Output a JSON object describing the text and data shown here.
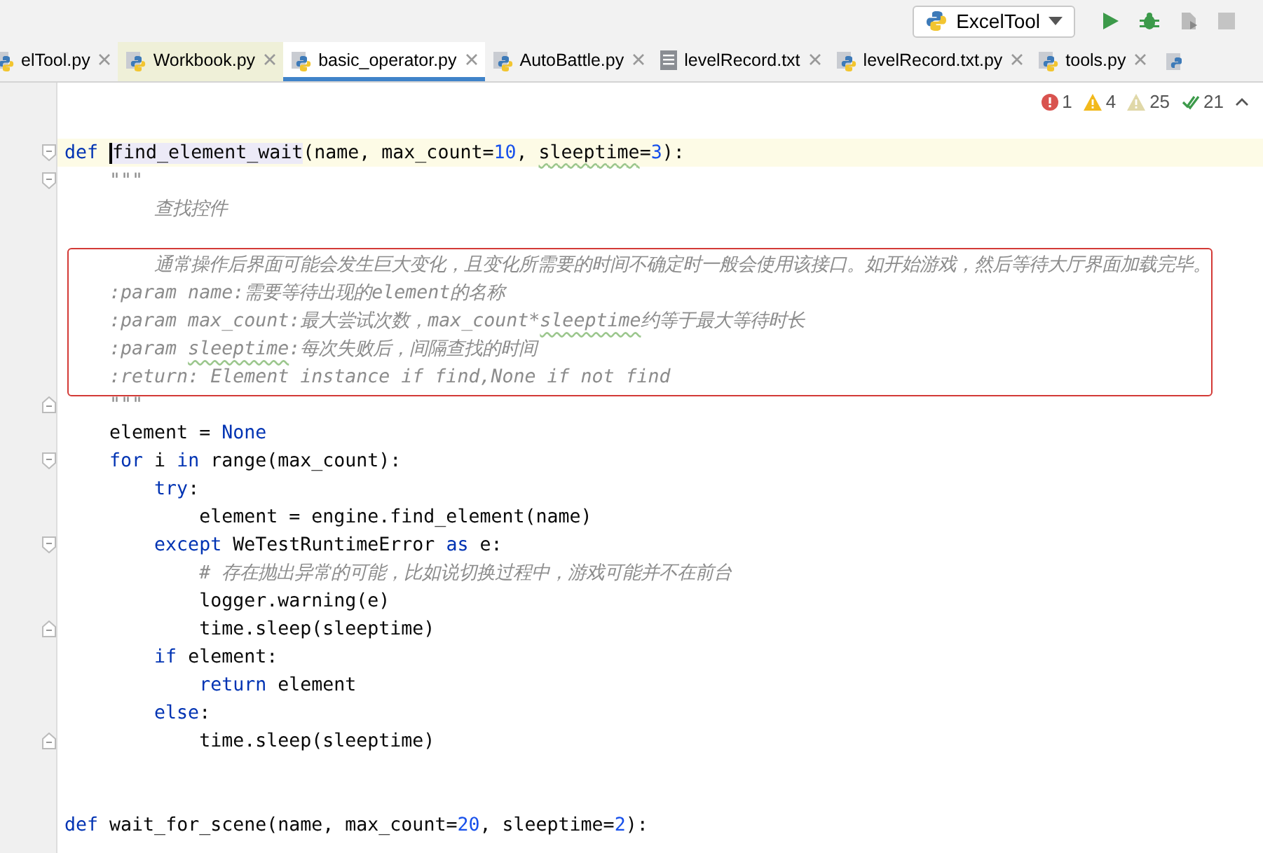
{
  "toolbar": {
    "run_config": "ExcelTool",
    "actions": [
      {
        "kind": "run",
        "disabled": false
      },
      {
        "kind": "debug",
        "disabled": false
      },
      {
        "kind": "coverage",
        "disabled": true
      },
      {
        "kind": "stop",
        "disabled": true
      }
    ]
  },
  "tabs": [
    {
      "label": "elTool.py",
      "kind": "python",
      "selected": false,
      "highlighted": false
    },
    {
      "label": "Workbook.py",
      "kind": "python",
      "selected": false,
      "highlighted": true
    },
    {
      "label": "basic_operator.py",
      "kind": "python",
      "selected": true,
      "highlighted": false
    },
    {
      "label": "AutoBattle.py",
      "kind": "python",
      "selected": false,
      "highlighted": false
    },
    {
      "label": "levelRecord.txt",
      "kind": "text",
      "selected": false,
      "highlighted": false
    },
    {
      "label": "levelRecord.txt.py",
      "kind": "python",
      "selected": false,
      "highlighted": false
    },
    {
      "label": "tools.py",
      "kind": "python",
      "selected": false,
      "highlighted": false
    }
  ],
  "inspections": [
    {
      "kind": "error",
      "count": "1"
    },
    {
      "kind": "warning",
      "count": "4"
    },
    {
      "kind": "weak",
      "count": "25"
    },
    {
      "kind": "typo",
      "count": "21"
    }
  ],
  "lines": [
    {
      "kind": "blank"
    },
    {
      "kind": "blank"
    },
    {
      "kind": "code",
      "current": true,
      "fold_start": true,
      "tokens": [
        {
          "kind": "keyword",
          "text": "def "
        },
        {
          "kind": "matched",
          "text": "find_element_wait",
          "caret": true
        },
        {
          "kind": "plain",
          "text": "(name, max_count="
        },
        {
          "kind": "number",
          "text": "10"
        },
        {
          "kind": "plain",
          "text": ", "
        },
        {
          "kind": "typo",
          "text": "sleeptime"
        },
        {
          "kind": "plain",
          "text": "="
        },
        {
          "kind": "number",
          "text": "3"
        },
        {
          "kind": "plain",
          "text": "):"
        }
      ]
    },
    {
      "kind": "code",
      "fold_start": true,
      "tokens": [
        {
          "kind": "doc",
          "text": "    \"\"\""
        }
      ]
    },
    {
      "kind": "code",
      "tokens": [
        {
          "kind": "doc",
          "text": "        查找控件"
        }
      ]
    },
    {
      "kind": "blank"
    },
    {
      "kind": "code",
      "annotated": true,
      "tokens": [
        {
          "kind": "doc",
          "text": "        通常操作后界面可能会发生巨大变化，且变化所需要的时间不确定时一般会使用该接口。如开始游戏，然后等待大厅界面加载完毕。"
        }
      ]
    },
    {
      "kind": "code",
      "annotated": true,
      "tokens": [
        {
          "kind": "doc",
          "text": "    :param name:需要等待出现的element的名称"
        }
      ]
    },
    {
      "kind": "code",
      "annotated": true,
      "tokens": [
        {
          "kind": "doc",
          "text": "    :param max_count:最大尝试次数，max_count*"
        },
        {
          "kind": "doctypo",
          "text": "sleeptime"
        },
        {
          "kind": "doc",
          "text": "约等于最大等待时长"
        }
      ]
    },
    {
      "kind": "code",
      "annotated": true,
      "tokens": [
        {
          "kind": "doc",
          "text": "    :param "
        },
        {
          "kind": "doctypo",
          "text": "sleeptime"
        },
        {
          "kind": "doc",
          "text": ":每次失败后，间隔查找的时间"
        }
      ]
    },
    {
      "kind": "code",
      "annotated": true,
      "tokens": [
        {
          "kind": "doc",
          "text": "    :return: Element instance if find,None if not find"
        }
      ]
    },
    {
      "kind": "code",
      "fold_end": true,
      "tokens": [
        {
          "kind": "doc",
          "text": "    \"\"\""
        }
      ]
    },
    {
      "kind": "code",
      "tokens": [
        {
          "kind": "plain",
          "text": "    element = "
        },
        {
          "kind": "keyword",
          "text": "None"
        }
      ]
    },
    {
      "kind": "code",
      "fold_start": true,
      "tokens": [
        {
          "kind": "keyword",
          "text": "    for"
        },
        {
          "kind": "plain",
          "text": " i "
        },
        {
          "kind": "keyword",
          "text": "in"
        },
        {
          "kind": "plain",
          "text": " range(max_count):"
        }
      ]
    },
    {
      "kind": "code",
      "tokens": [
        {
          "kind": "keyword",
          "text": "        try"
        },
        {
          "kind": "plain",
          "text": ":"
        }
      ]
    },
    {
      "kind": "code",
      "tokens": [
        {
          "kind": "plain",
          "text": "            element = engine.find_element(name)"
        }
      ]
    },
    {
      "kind": "code",
      "fold_start": true,
      "tokens": [
        {
          "kind": "keyword",
          "text": "        except"
        },
        {
          "kind": "plain",
          "text": " WeTestRuntimeError "
        },
        {
          "kind": "keyword",
          "text": "as"
        },
        {
          "kind": "plain",
          "text": " e:"
        }
      ]
    },
    {
      "kind": "code",
      "tokens": [
        {
          "kind": "comment",
          "text": "            # 存在抛出异常的可能，比如说切换过程中，游戏可能并不在前台"
        }
      ]
    },
    {
      "kind": "code",
      "tokens": [
        {
          "kind": "plain",
          "text": "            logger.warning(e)"
        }
      ]
    },
    {
      "kind": "code",
      "fold_end": true,
      "tokens": [
        {
          "kind": "plain",
          "text": "            time.sleep(sleeptime)"
        }
      ]
    },
    {
      "kind": "code",
      "tokens": [
        {
          "kind": "keyword",
          "text": "        if"
        },
        {
          "kind": "plain",
          "text": " element:"
        }
      ]
    },
    {
      "kind": "code",
      "tokens": [
        {
          "kind": "keyword",
          "text": "            return"
        },
        {
          "kind": "plain",
          "text": " element"
        }
      ]
    },
    {
      "kind": "code",
      "tokens": [
        {
          "kind": "keyword",
          "text": "        else"
        },
        {
          "kind": "plain",
          "text": ":"
        }
      ]
    },
    {
      "kind": "code",
      "fold_end": true,
      "tokens": [
        {
          "kind": "plain",
          "text": "            time.sleep(sleeptime)"
        }
      ]
    },
    {
      "kind": "blank"
    },
    {
      "kind": "blank"
    },
    {
      "kind": "code",
      "tokens": [
        {
          "kind": "keyword",
          "text": "def"
        },
        {
          "kind": "plain",
          "text": " wait_for_scene(name, max_count="
        },
        {
          "kind": "number",
          "text": "20"
        },
        {
          "kind": "plain",
          "text": ", sleeptime="
        },
        {
          "kind": "number",
          "text": "2"
        },
        {
          "kind": "plain",
          "text": "):"
        }
      ]
    }
  ]
}
